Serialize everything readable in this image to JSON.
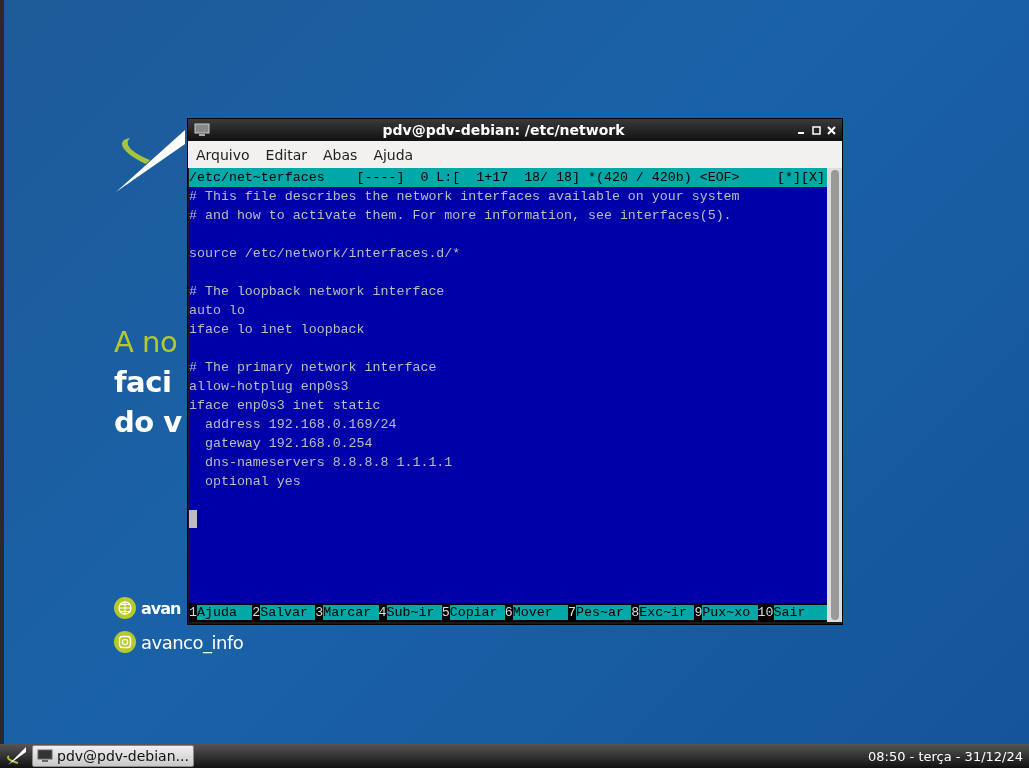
{
  "wallpaper": {
    "tagline": [
      "A no",
      "faci",
      "do v"
    ],
    "social": [
      {
        "kind": "web",
        "handle": "avan"
      },
      {
        "kind": "instagram",
        "handle": "avanco_info"
      }
    ]
  },
  "window": {
    "title": "pdv@pdv-debian: /etc/network",
    "menu": [
      "Arquivo",
      "Editar",
      "Abas",
      "Ajuda"
    ],
    "editor": {
      "status": "/etc/net~terfaces    [----]  0 L:[  1+17  18/ 18] *(420 / 420b) <EOF>",
      "status_flags": "[*][X]",
      "paragraphs": [
        [
          "# This file describes the network interfaces available on your system",
          "# and how to activate them. For more information, see interfaces(5)."
        ],
        [
          "source /etc/network/interfaces.d/*"
        ],
        [
          "# The loopback network interface",
          "auto lo",
          "iface lo inet loopback"
        ],
        [
          "# The primary network interface",
          "allow-hotplug enp0s3",
          "iface enp0s3 inet static",
          "  address 192.168.0.169/24",
          "  gateway 192.168.0.254",
          "  dns-nameservers 8.8.8.8 1.1.1.1",
          "  optional yes"
        ]
      ],
      "cursor_line": true,
      "function_keys": [
        {
          "num": "1",
          "label": "Ajuda"
        },
        {
          "num": "2",
          "label": "Salvar"
        },
        {
          "num": "3",
          "label": "Marcar"
        },
        {
          "num": "4",
          "label": "Sub~ir"
        },
        {
          "num": "5",
          "label": "Copiar"
        },
        {
          "num": "6",
          "label": "Mover"
        },
        {
          "num": "7",
          "label": "Pes~ar"
        },
        {
          "num": "8",
          "label": "Exc~ir"
        },
        {
          "num": "9",
          "label": "Pux~xo"
        },
        {
          "num": "10",
          "label": "Sair"
        }
      ]
    }
  },
  "taskbar": {
    "tasks": [
      {
        "label": "pdv@pdv-debian...",
        "selected": true
      }
    ],
    "clock": "08:50 - terça - 31/12/24"
  }
}
